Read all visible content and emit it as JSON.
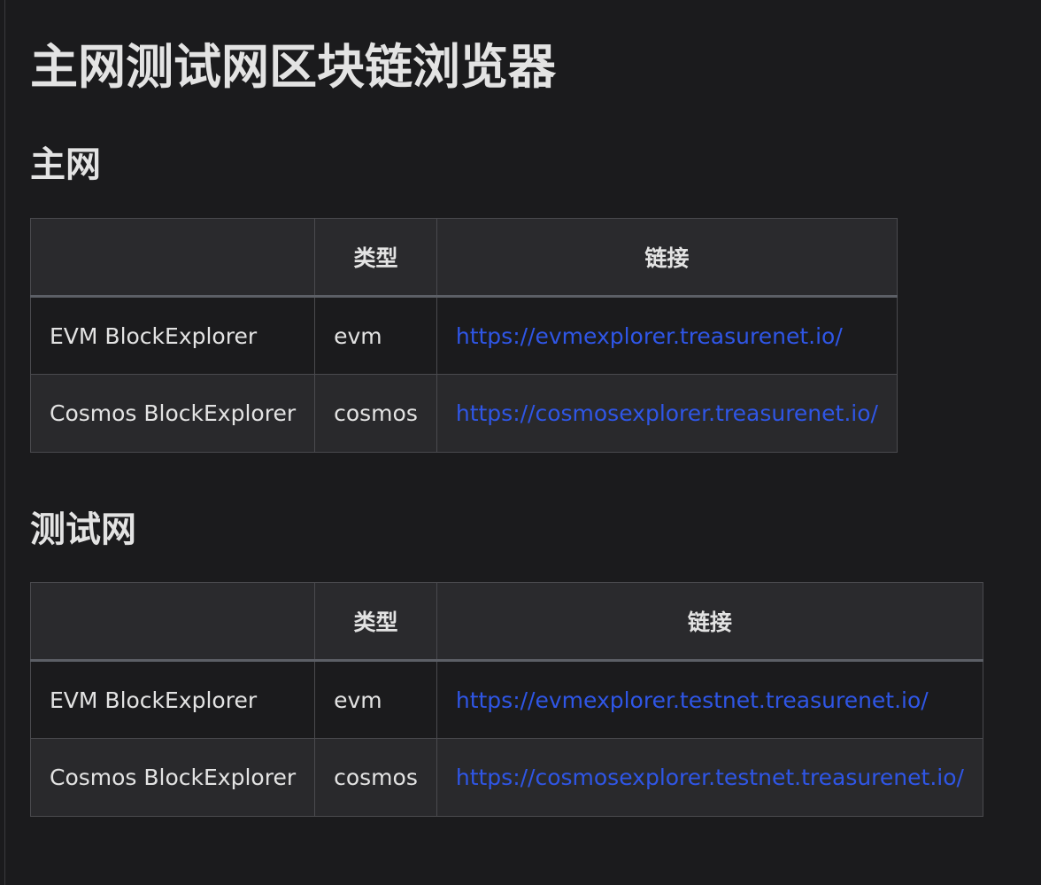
{
  "page": {
    "title": "主网测试网区块链浏览器"
  },
  "sections": [
    {
      "heading": "主网",
      "table": {
        "headers": [
          "",
          "类型",
          "链接"
        ],
        "rows": [
          {
            "name": "EVM BlockExplorer",
            "type": "evm",
            "link": "https://evmexplorer.treasurenet.io/"
          },
          {
            "name": "Cosmos BlockExplorer",
            "type": "cosmos",
            "link": "https://cosmosexplorer.treasurenet.io/"
          }
        ]
      }
    },
    {
      "heading": "测试网",
      "table": {
        "headers": [
          "",
          "类型",
          "链接"
        ],
        "rows": [
          {
            "name": "EVM BlockExplorer",
            "type": "evm",
            "link": "https://evmexplorer.testnet.treasurenet.io/"
          },
          {
            "name": "Cosmos BlockExplorer",
            "type": "cosmos",
            "link": "https://cosmosexplorer.testnet.treasurenet.io/"
          }
        ]
      }
    }
  ],
  "colors": {
    "background": "#1b1b1d",
    "text": "#e3e3e3",
    "link": "#2f56e6",
    "header_bg": "#2a2a2d",
    "alt_row_bg": "#29292c",
    "border": "#4a4a4e"
  }
}
